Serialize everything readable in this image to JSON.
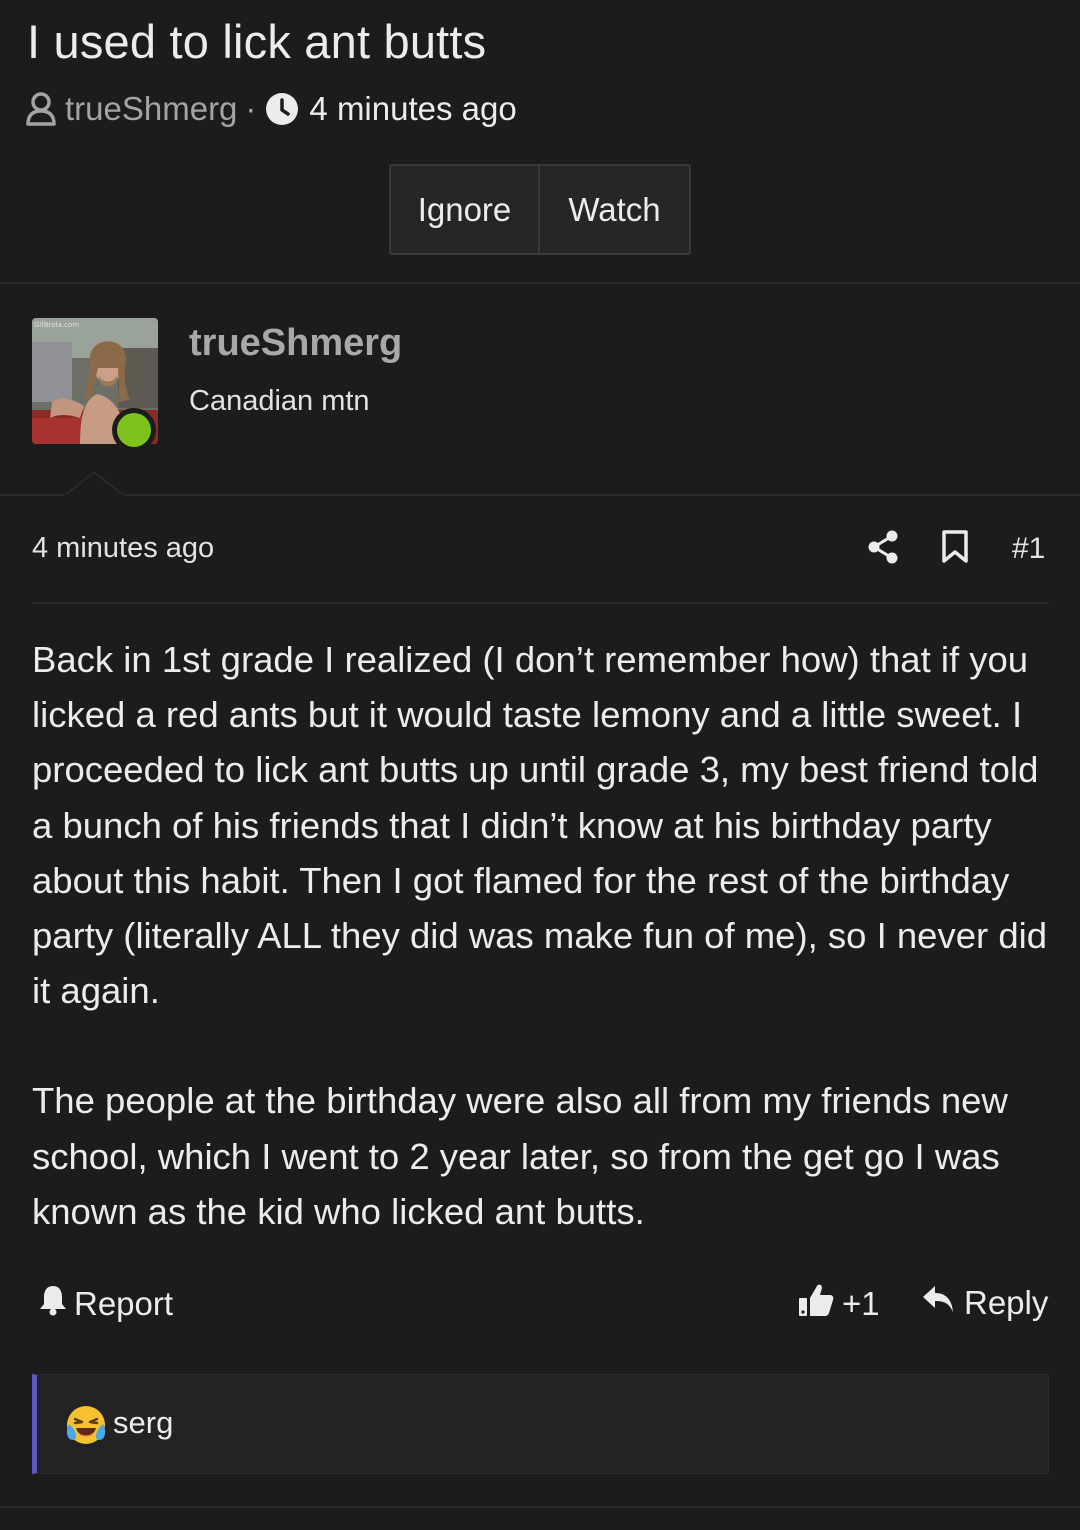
{
  "thread": {
    "title": "I used to lick ant butts",
    "author": "trueShmerg",
    "separator": "·",
    "time": "4 minutes ago",
    "actions": {
      "ignore": "Ignore",
      "watch": "Watch"
    }
  },
  "author_block": {
    "name": "trueShmerg",
    "user_title": "Canadian mtn",
    "online": true,
    "avatar_watermark": "GifBrola.com"
  },
  "post": {
    "time": "4 minutes ago",
    "number": "#1",
    "paragraphs": [
      "Back in 1st grade I realized (I don’t remember how) that if you licked a red ants but it would taste lemony and a little sweet. I proceeded to lick ant butts up until grade 3, my best friend told a bunch of his friends that I didn’t know at his birthday party about this habit. Then I got flamed for the rest of the birthday party (literally ALL they did was make fun of me), so I never did it again.",
      "The people at the birthday were also all from my friends new school, which I went to 2 year later, so from the get go I was known as the kid who licked ant butts."
    ],
    "report_label": "Report",
    "like_count": "+1",
    "reply_label": "Reply"
  },
  "reactions": {
    "user": "serg",
    "emoji": "crying-laughing-emoji"
  },
  "colors": {
    "background": "#1c1c1c",
    "online": "#7cc41c",
    "reaction_accent": "#5a5ac0"
  }
}
